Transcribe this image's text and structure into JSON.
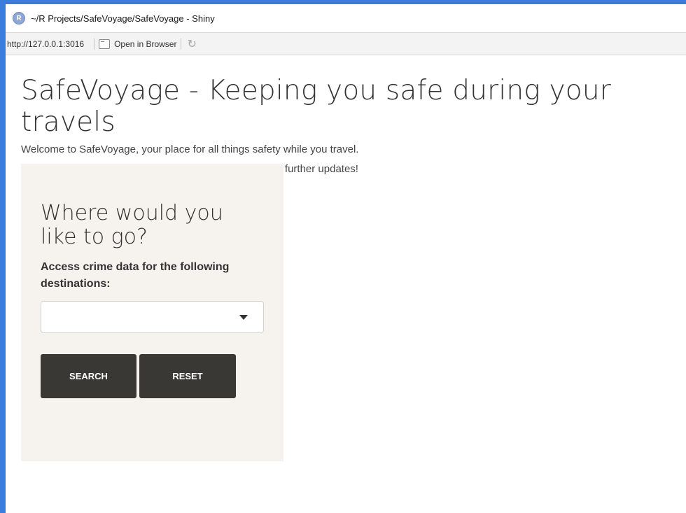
{
  "window": {
    "title": "~/R Projects/SafeVoyage/SafeVoyage - Shiny",
    "logo_letter": "R"
  },
  "urlbar": {
    "url": "http://127.0.0.1:3016",
    "open_browser_label": "Open in Browser"
  },
  "page": {
    "title": "SafeVoyage - Keeping you safe during your travels",
    "intro_line_1": "Welcome to SafeVoyage, your place for all things safety while you travel.",
    "intro_line_2": "Have fun playing around with our app and stay tuned for further updates!"
  },
  "panel": {
    "title": "Where would you like to go?",
    "label": "Access crime data for the following destinations:",
    "select_value": "",
    "search_label": "SEARCH",
    "reset_label": "RESET"
  },
  "icons": {
    "logo": "r-logo-icon",
    "open_browser": "open-browser-icon",
    "refresh": "refresh-icon",
    "dropdown": "chevron-down-icon"
  },
  "colors": {
    "panel_bg": "#f6f3ef",
    "button_bg": "#393834",
    "desktop_bg": "#3b7ddd"
  }
}
